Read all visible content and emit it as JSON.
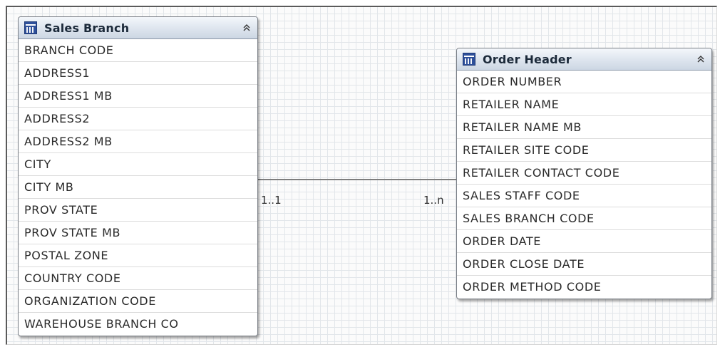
{
  "entities": {
    "sales_branch": {
      "title": "Sales Branch",
      "collapse_glyph": "≈",
      "fields": [
        "BRANCH  CODE",
        "ADDRESS1",
        "ADDRESS1  MB",
        "ADDRESS2",
        "ADDRESS2  MB",
        "CITY",
        "CITY  MB",
        "PROV  STATE",
        "PROV  STATE  MB",
        "POSTAL  ZONE",
        "COUNTRY  CODE",
        "ORGANIZATION  CODE",
        "WAREHOUSE  BRANCH  CO"
      ]
    },
    "order_header": {
      "title": "Order Header",
      "collapse_glyph": "≈",
      "fields": [
        "ORDER  NUMBER",
        "RETAILER  NAME",
        "RETAILER  NAME  MB",
        "RETAILER  SITE  CODE",
        "RETAILER  CONTACT  CODE",
        "SALES  STAFF  CODE",
        "SALES  BRANCH  CODE",
        "ORDER  DATE",
        "ORDER  CLOSE  DATE",
        "ORDER  METHOD  CODE"
      ]
    }
  },
  "relationship": {
    "left_cardinality": "1..1",
    "right_cardinality": "1..n"
  },
  "icons": {
    "entity_icon": "table-icon",
    "collapse_icon": "collapse-chevrons-icon"
  }
}
